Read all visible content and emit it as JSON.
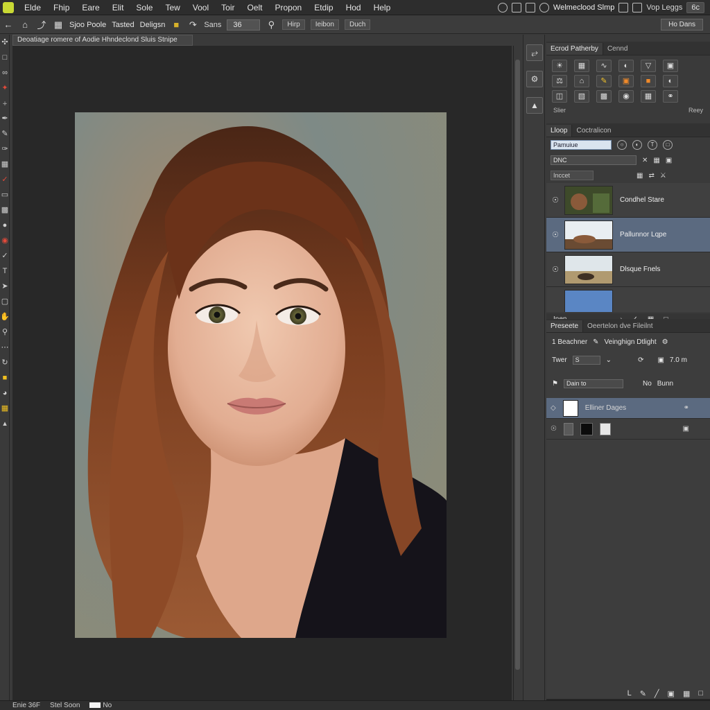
{
  "menu": {
    "items": [
      "Elde",
      "Fhip",
      "Eare",
      "Elit",
      "Sole",
      "Tew",
      "Vool",
      "Toir",
      "Oelt",
      "Propon",
      "Etdip",
      "Hod",
      "Help"
    ],
    "workspace_name": "Welmeclood Slmp",
    "right_label": "Vop Leggs",
    "right_field": "6c"
  },
  "options": {
    "preset": "Sjoo Poole",
    "mode": "Tasted",
    "action": "Deligsn",
    "size_label": "Sans",
    "size_value": "36",
    "box1": "Hirp",
    "box2": "Ieibon",
    "box3": "Duch",
    "right_button": "Ho Dans"
  },
  "document": {
    "tab_title": "Deoatiage romere of Aodie Hhndeclond Sluis Stnipe"
  },
  "status": {
    "zoom": "Enie 36F",
    "doc": "Stel Soon",
    "swatch_label": "No"
  },
  "adjustments": {
    "tabs": [
      "Ecrod Patherby",
      "Cennd"
    ],
    "footer_left": "Slier",
    "footer_right": "Reey"
  },
  "layers": {
    "tabs": [
      "Lloop",
      "Coctralicon"
    ],
    "kind": "Pamuiue",
    "blend": "DNC",
    "lock": "Inccet",
    "items": [
      {
        "name": "Condhel Stare",
        "selected": false
      },
      {
        "name": "Pallunnor Lqpe",
        "selected": true
      },
      {
        "name": "Dlsque Fnels",
        "selected": false
      },
      {
        "name": "",
        "selected": false
      }
    ],
    "footer_label": "Inen"
  },
  "props": {
    "tabs": [
      "Preseete",
      "Oeertelon dve Fileilnt"
    ],
    "row1_left": "1 Beachner",
    "row1_right": "Veinghign Dtlight",
    "tone_label": "Twer",
    "tone_value": "S",
    "size_value": "7.0 m",
    "blend_select": "Dain to",
    "no_label": "No",
    "mode_label": "Bunn",
    "layer1_name": "Elliner Dages"
  },
  "colors": {
    "accent_yellow": "#c9d934",
    "selection_blue": "#5b6a80"
  }
}
